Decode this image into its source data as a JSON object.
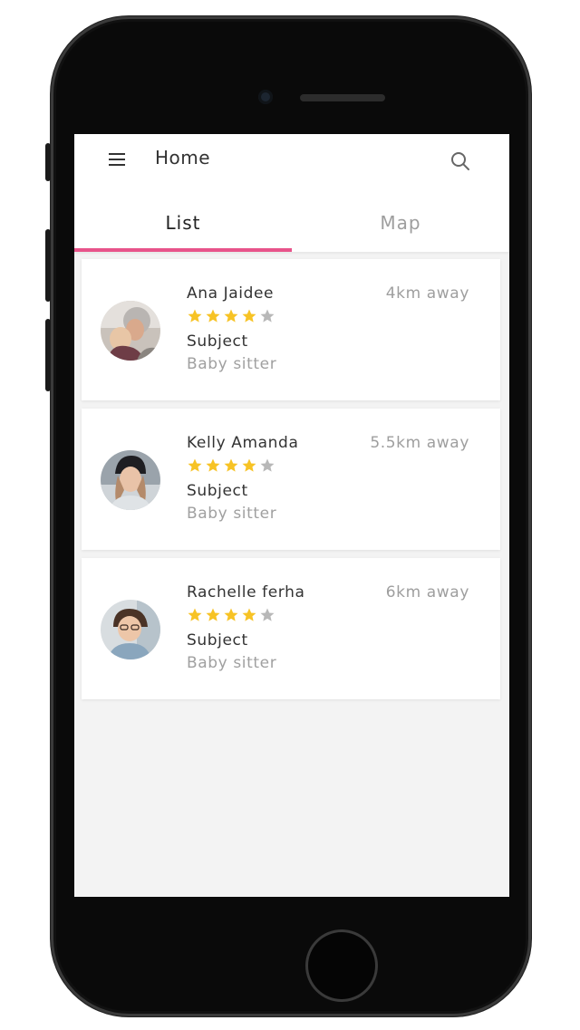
{
  "app": {
    "title": "Home"
  },
  "tabs": [
    {
      "label": "List",
      "active": true
    },
    {
      "label": "Map",
      "active": false
    }
  ],
  "icons": {
    "menu": "hamburger-menu-icon",
    "search": "search-icon",
    "star": "star-icon"
  },
  "colors": {
    "accent": "#e8538a",
    "star_filled": "#f7c325",
    "star_empty": "#b8b8b8",
    "background": "#f3f3f3"
  },
  "caregivers": [
    {
      "name": "Ana Jaidee",
      "distance": "4km away",
      "rating": 4,
      "max_rating": 5,
      "subject_label": "Subject",
      "role": "Baby sitter"
    },
    {
      "name": "Kelly Amanda",
      "distance": "5.5km away",
      "rating": 4,
      "max_rating": 5,
      "subject_label": "Subject",
      "role": "Baby sitter"
    },
    {
      "name": "Rachelle ferha",
      "distance": "6km away",
      "rating": 4,
      "max_rating": 5,
      "subject_label": "Subject",
      "role": "Baby sitter"
    }
  ]
}
